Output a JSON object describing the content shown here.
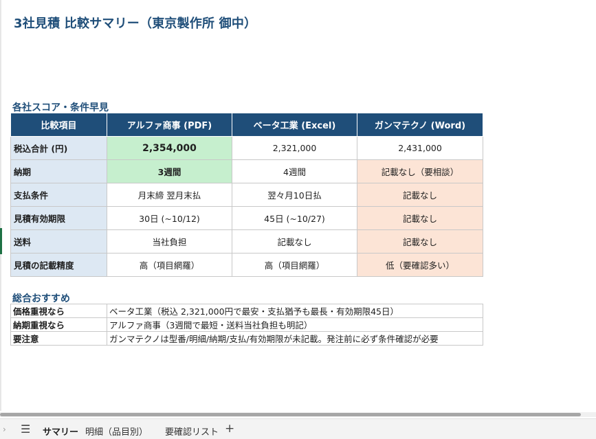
{
  "title": "3社見積 比較サマリー（東京製作所 御中）",
  "section_scores": "各社スコア・条件早見",
  "section_reco": "総合おすすめ",
  "score_table": {
    "headers": [
      "比較項目",
      "アルファ商事 (PDF)",
      "ベータ工業 (Excel)",
      "ガンマテクノ (Word)"
    ],
    "rows": [
      {
        "label": "税込合計 (円)",
        "cells": [
          "2,354,000",
          "2,321,000",
          "2,431,000"
        ]
      },
      {
        "label": "納期",
        "cells": [
          "3週間",
          "4週間",
          "記載なし（要相談）"
        ]
      },
      {
        "label": "支払条件",
        "cells": [
          "月末締 翌月末払",
          "翌々月10日払",
          "記載なし"
        ]
      },
      {
        "label": "見積有効期限",
        "cells": [
          "30日 (~10/12)",
          "45日 (~10/27)",
          "記載なし"
        ]
      },
      {
        "label": "送料",
        "cells": [
          "当社負担",
          "記載なし",
          "記載なし"
        ]
      },
      {
        "label": "見積の記載精度",
        "cells": [
          "高（項目網羅）",
          "高（項目網羅）",
          "低（要確認多い）"
        ]
      }
    ]
  },
  "recommendations": [
    {
      "key": "価格重視なら",
      "value": "ベータ工業（税込 2,321,000円で最安・支払猶予も最長・有効期限45日）"
    },
    {
      "key": "納期重視なら",
      "value": "アルファ商事（3週間で最短・送料当社負担も明記）"
    },
    {
      "key": "要注意",
      "value": "ガンマテクノは型番/明細/納期/支払/有効期限が未記載。発注前に必ず条件確認が必要"
    }
  ],
  "sheet_tabs": [
    "サマリー",
    "明細（品目別）",
    "要確認リスト"
  ],
  "active_tab": "サマリー",
  "icons": {
    "nav": "chevron-right-icon",
    "menu": "hamburger-menu-icon",
    "add": "plus-icon"
  },
  "colors": {
    "title": "#1f4e79",
    "header_bg": "#1f4e79",
    "label_bg": "#dde8f3",
    "best_bg": "#c6efce",
    "warn_bg": "#fce4d6"
  }
}
